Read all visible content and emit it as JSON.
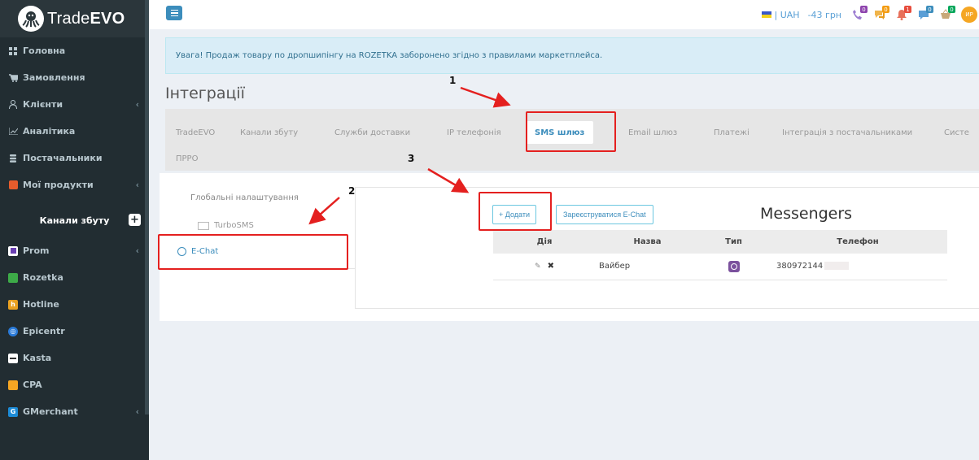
{
  "brand": {
    "logo_text_light": "Trade",
    "logo_text_bold": "EVO"
  },
  "sidebar": {
    "items": [
      {
        "label": "Головна",
        "icon": "dashboard-icon",
        "chevron": false
      },
      {
        "label": "Замовлення",
        "icon": "cart-icon",
        "chevron": false
      },
      {
        "label": "Клієнти",
        "icon": "user-icon",
        "chevron": true
      },
      {
        "label": "Аналітика",
        "icon": "chart-icon",
        "chevron": false
      },
      {
        "label": "Постачальники",
        "icon": "database-icon",
        "chevron": false
      },
      {
        "label": "Мої продукти",
        "icon": "products-icon",
        "chevron": true
      }
    ],
    "channels_header": "Канали збуту",
    "channels": [
      {
        "label": "Prom",
        "icon": "prom-icon",
        "color": "#6a3fb3",
        "chevron": true
      },
      {
        "label": "Rozetka",
        "icon": "rozetka-icon",
        "color": "#3daa48",
        "chevron": false
      },
      {
        "label": "Hotline",
        "icon": "hotline-icon",
        "color": "#e8a020",
        "chevron": false
      },
      {
        "label": "Epicentr",
        "icon": "epicentr-icon",
        "color": "#2a7ad8",
        "chevron": false
      },
      {
        "label": "Kasta",
        "icon": "kasta-icon",
        "color": "#ffffff",
        "chevron": false
      },
      {
        "label": "CPA",
        "icon": "cpa-icon",
        "color": "#f5a623",
        "chevron": false
      },
      {
        "label": "GMerchant",
        "icon": "google-icon",
        "color": "#1c8bd6",
        "chevron": true
      }
    ]
  },
  "topbar": {
    "currency": "| UAH",
    "balance": "-43 грн",
    "notifications": [
      {
        "icon": "phone-icon",
        "badge": "0",
        "badge_color": "#8e44ad"
      },
      {
        "icon": "chat-icon",
        "badge": "0",
        "badge_color": "#f39c12"
      },
      {
        "icon": "bell-icon",
        "badge": "1",
        "badge_color": "#e74c3c"
      },
      {
        "icon": "message-icon",
        "badge": "0",
        "badge_color": "#3c8dbc"
      },
      {
        "icon": "basket-icon",
        "badge": "0",
        "badge_color": "#00a65a"
      }
    ],
    "avatar": "ИР"
  },
  "alert_text": "Увага! Продаж товару по дропшипінгу на ROZETKA заборонено згідно з правилами маркетплейса.",
  "page_title": "Інтеграції",
  "tabs": [
    "TradeEVO",
    "Канали збуту",
    "Служби доставки",
    "IP телефонія",
    "SMS шлюз",
    "Email шлюз",
    "Платежі",
    "Інтеграція з постачальниками",
    "Систе",
    "ПРРО"
  ],
  "active_tab": "SMS шлюз",
  "left_menu": {
    "header": "Глобальні налаштування",
    "items": [
      "TurboSMS",
      "E-Chat"
    ]
  },
  "buttons": {
    "add": "+ Додати",
    "register": "Зареєструватися E-Chat"
  },
  "messengers_title": "Messengers",
  "table": {
    "headers": [
      "Дія",
      "Назва",
      "Тип",
      "Телефон"
    ],
    "rows": [
      {
        "name": "Вайбер",
        "type": "viber-icon",
        "phone": "380972144"
      }
    ]
  },
  "annotations": [
    "1",
    "2",
    "3"
  ],
  "annotation_color": "#e4201f"
}
